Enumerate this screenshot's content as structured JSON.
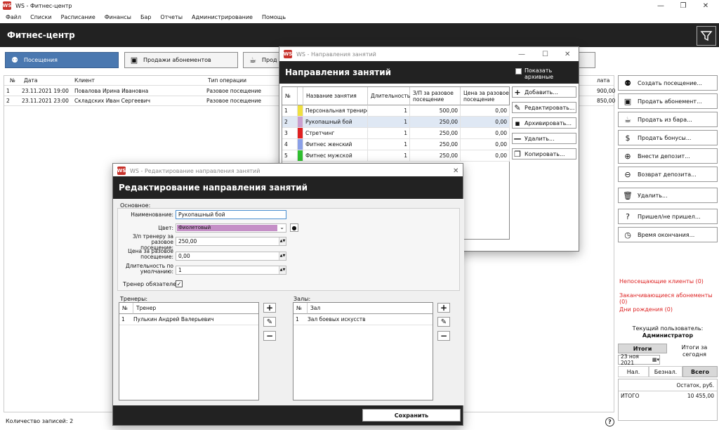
{
  "window": {
    "title": "WS - Фитнес-центр",
    "app_icon": "WS"
  },
  "menu": [
    "Файл",
    "Списки",
    "Расписание",
    "Финансы",
    "Бар",
    "Отчеты",
    "Администрирование",
    "Помощь"
  ],
  "header": {
    "title": "Фитнес-центр"
  },
  "tabs": [
    {
      "label": "Посещения"
    },
    {
      "label": "Продажи абонементов"
    },
    {
      "label": "Прод"
    },
    {
      "label": ""
    }
  ],
  "main_table": {
    "columns": [
      "№",
      "Дата",
      "Клиент",
      "Тип операции",
      "лата"
    ],
    "rows": [
      {
        "n": "1",
        "date": "23.11.2021 19:00",
        "client": "Повалова Ирина Ивановна",
        "type": "Разовое посещение",
        "sum": "900,00"
      },
      {
        "n": "2",
        "date": "23.11.2021 23:00",
        "client": "Складских Иван Сергеевич",
        "type": "Разовое посещение",
        "sum": "850,00"
      }
    ]
  },
  "right_panel": {
    "buttons": [
      "Создать посещение...",
      "Продать абонемент...",
      "Продать из бара...",
      "Продать бонусы...",
      "Внести депозит...",
      "Возврат депозита...",
      "Удалить...",
      "Пришел/не пришел...",
      "Время окончания..."
    ],
    "links": [
      "Непосещающие клиенты (0)",
      "Заканчивающиеся абонементы (0)",
      "Дни рождения (0)"
    ],
    "current_user_label": "Текущий пользователь:",
    "current_user": "Администратор",
    "totals_tab": "Итоги",
    "today_tab": "Итоги за сегодня",
    "date": "23 ноя  2021",
    "subtabs": [
      "Нал.",
      "Безнал.",
      "Всего"
    ],
    "balance_header": "Остаток, руб.",
    "total_label": "ИТОГО",
    "total_value": "10 455,00"
  },
  "status": {
    "count": "Количество записей: 2"
  },
  "dlg1": {
    "title": "WS - Направления занятий",
    "header": "Направления занятий",
    "archive_label": "Показать архивные",
    "columns": [
      "№",
      "Название занятия",
      "Длительность",
      "З/П за разовое посещение",
      "Цена за разовое посещение"
    ],
    "rows": [
      {
        "n": "1",
        "color": "#f0e040",
        "name": "Персональная трениров",
        "dur": "1",
        "pay": "500,00",
        "price": "0,00"
      },
      {
        "n": "2",
        "color": "#c8a0d0",
        "name": "Рукопашный бой",
        "dur": "1",
        "pay": "250,00",
        "price": "0,00"
      },
      {
        "n": "3",
        "color": "#e02020",
        "name": "Стретчинг",
        "dur": "1",
        "pay": "250,00",
        "price": "0,00"
      },
      {
        "n": "4",
        "color": "#8aa0e8",
        "name": "Фитнес женский",
        "dur": "1",
        "pay": "250,00",
        "price": "0,00"
      },
      {
        "n": "5",
        "color": "#30c030",
        "name": "Фитнес мужской",
        "dur": "1",
        "pay": "250,00",
        "price": "0,00"
      }
    ],
    "actions": [
      "Добавить...",
      "Редактировать...",
      "Архивировать...",
      "Удалить...",
      "Копировать..."
    ]
  },
  "dlg2": {
    "title": "WS - Редактирование направления занятий",
    "header": "Редактирование направления занятий",
    "section": "Основное:",
    "name_label": "Наименование:",
    "name_value": "Рукопашный бой",
    "color_label": "Цвет:",
    "color_value": "Фиолетовый",
    "color_hex": "#c58fc7",
    "pay_label": "З/п тренеру за разовое посещение:",
    "pay_value": "250,00",
    "price_label": "Цена за разовое посещение:",
    "price_value": "0,00",
    "dur_label": "Длительность по умолчанию:",
    "dur_value": "1",
    "trainer_req_label": "Тренер обязателен:",
    "trainers_label": "Тренеры:",
    "trainers_cols": [
      "№",
      "Тренер"
    ],
    "trainers": [
      {
        "n": "1",
        "name": "Пулькин Андрей Валерьевич"
      }
    ],
    "halls_label": "Залы:",
    "halls_cols": [
      "№",
      "Зал"
    ],
    "halls": [
      {
        "n": "1",
        "name": "Зал боевых искусств"
      }
    ],
    "save": "Сохранить"
  }
}
